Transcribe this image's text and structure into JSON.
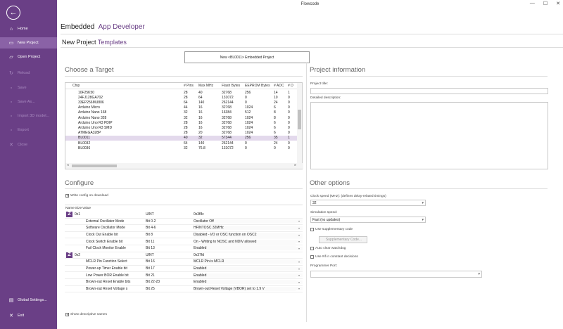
{
  "window": {
    "title": "Flowcode"
  },
  "sidebar": {
    "items": [
      {
        "label": "Home",
        "icon": "home-icon",
        "glyph": "⌂",
        "state": "normal"
      },
      {
        "label": "New Project",
        "icon": "new-document-icon",
        "glyph": "▭",
        "state": "active"
      },
      {
        "label": "Open Project",
        "icon": "folder-icon",
        "glyph": "▱",
        "state": "normal"
      },
      {
        "label": "Reload",
        "icon": "reload-icon",
        "glyph": "↻",
        "state": "disabled"
      },
      {
        "label": "Save",
        "icon": "save-icon",
        "glyph": "▫",
        "state": "disabled"
      },
      {
        "label": "Save As...",
        "icon": "save-as-icon",
        "glyph": "▫",
        "state": "disabled"
      },
      {
        "label": "Import 3D model...",
        "icon": "import-icon",
        "glyph": "▫",
        "state": "disabled"
      },
      {
        "label": "Export",
        "icon": "export-icon",
        "glyph": "▫",
        "state": "disabled"
      },
      {
        "label": "Close",
        "icon": "close-icon",
        "glyph": "✕",
        "state": "disabled"
      }
    ],
    "bottom": [
      {
        "label": "Global Settings...",
        "icon": "settings-icon",
        "glyph": "▤"
      },
      {
        "label": "Exit",
        "icon": "exit-icon",
        "glyph": "✕"
      }
    ],
    "accent": "#6a3f86"
  },
  "tabs_top": [
    "Embedded",
    "App Developer"
  ],
  "tabs_sub": [
    "New Project",
    "Templates"
  ],
  "new_project_button": "New <BL0011> Embedded Project",
  "target": {
    "heading": "Choose a Target",
    "columns": [
      "Chip",
      "# Pins",
      "Max MHz",
      "Flash Bytes",
      "EEPROM Bytes",
      "# ADC",
      "# D"
    ],
    "rows": [
      [
        "10F25K50",
        "28",
        "40",
        "32768",
        "256",
        "14",
        "1"
      ],
      [
        "24FJ128GA702",
        "28",
        "64",
        "131072",
        "0",
        "10",
        "0"
      ],
      [
        "33EP256MU806",
        "64",
        "140",
        "262144",
        "0",
        "24",
        "0"
      ],
      [
        "Arduino Micro",
        "44",
        "16",
        "32768",
        "1024",
        "6",
        "0"
      ],
      [
        "Arduino Nano 168",
        "32",
        "16",
        "16384",
        "512",
        "8",
        "0"
      ],
      [
        "Arduino Nano 328",
        "32",
        "16",
        "32768",
        "1024",
        "8",
        "0"
      ],
      [
        "Arduino Uno R3 PDIP",
        "28",
        "16",
        "32768",
        "1024",
        "6",
        "0"
      ],
      [
        "Arduino Uno R3 SMD",
        "28",
        "16",
        "32768",
        "1024",
        "6",
        "0"
      ],
      [
        "ATMEGA328P",
        "28",
        "20",
        "32768",
        "1024",
        "6",
        "0"
      ],
      [
        "BL0011",
        "40",
        "32",
        "57344",
        "256",
        "35",
        "1"
      ],
      [
        "BL0032",
        "64",
        "140",
        "262144",
        "0",
        "24",
        "0"
      ],
      [
        "BL0036",
        "32",
        "76.8",
        "131072",
        "0",
        "0",
        "0"
      ]
    ],
    "selected": "BL0011"
  },
  "project_info": {
    "heading": "Project information",
    "title_label": "Project title:",
    "title_value": "",
    "desc_label": "Detailed description:",
    "desc_value": ""
  },
  "configure": {
    "heading": "Configure",
    "write_config_label": "Write config on download",
    "write_config_checked": true,
    "columns": [
      "Name",
      "Size",
      "Value"
    ],
    "rows": [
      {
        "type": "group",
        "name": "0x1",
        "size": "UINT",
        "value": "0x3f8c"
      },
      {
        "type": "child",
        "name": "External Oscillator Mode",
        "size": "Bit 0-2",
        "value": "Oscillator Off"
      },
      {
        "type": "child",
        "name": "Software Oscillator Mode",
        "size": "Bit 4-6",
        "value": "HFINTOSC 32MHz"
      },
      {
        "type": "child",
        "name": "Clock Out Enable bit",
        "size": "Bit 8",
        "value": "Disabled - I/O or OSC function on OSC2"
      },
      {
        "type": "child",
        "name": "Clock Switch Enable bit",
        "size": "Bit 11",
        "value": "On - Writing to NOSC and NDIV allowed"
      },
      {
        "type": "child",
        "name": "Fail Clock Monitor Enable",
        "size": "Bit 13",
        "value": "Enabled"
      },
      {
        "type": "group",
        "name": "0x2",
        "size": "UINT",
        "value": "0x37fd"
      },
      {
        "type": "child",
        "name": "MCLR Pin Function Select",
        "size": "Bit 16",
        "value": "MCLR Pin is MCLR"
      },
      {
        "type": "child",
        "name": "Power-up Timer Enable bit",
        "size": "Bit 17",
        "value": "Enabled"
      },
      {
        "type": "child",
        "name": "Low Power BOR Enable bit",
        "size": "Bit 21",
        "value": "Enabled"
      },
      {
        "type": "child",
        "name": "Brown-out Reset Enable bits",
        "size": "Bit 22-23",
        "value": "Enabled"
      },
      {
        "type": "child",
        "name": "Brown-out Reset Voltage s",
        "size": "Bit 25",
        "value": "Brown-out Reset Voltage (VBOR) set to 1.9 V"
      }
    ],
    "show_desc_label": "Show descriptive names",
    "show_desc_checked": true
  },
  "other_options": {
    "heading": "Other options",
    "clock_label": "Clock speed (MHz): (defines delay-related timings)",
    "clock_value": "32",
    "sim_label": "Simulation speed:",
    "sim_value": "Fast (no updates)",
    "use_supp_label": "Use supplementary code",
    "use_supp_checked": false,
    "supp_button": "Supplementary Code...",
    "auto_clear_label": "Auto clear watchdog",
    "auto_clear_checked": false,
    "use_ifdef_label": "Use #if in constant decisions",
    "use_ifdef_checked": false,
    "programmer_label": "Programmer Port:",
    "programmer_value": ""
  }
}
